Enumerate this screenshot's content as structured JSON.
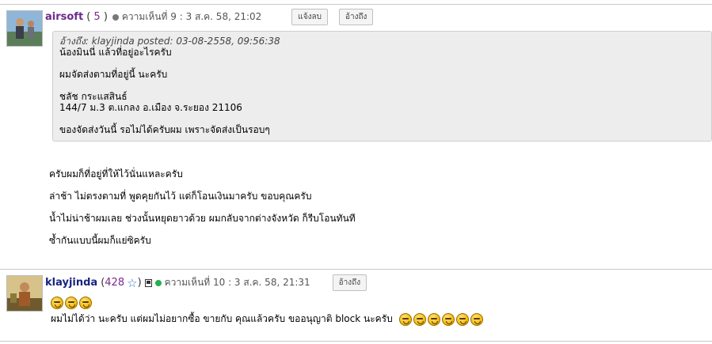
{
  "colors": {
    "accent_purple": "#6b2a8c",
    "username_blue": "#1a237e",
    "online_green": "#22b14c",
    "offline_gray": "#777777"
  },
  "posts": [
    {
      "username": "airsoft",
      "count_open": "(",
      "count": "5",
      "count_close": ")",
      "status": "offline",
      "meta": "ความเห็นที่ 9 : 3 ส.ค. 58, 21:02",
      "buttons": {
        "notify": "แจ้งลบ",
        "reply": "อ้างถึง"
      },
      "quote": {
        "header": "อ้างถึง: klayjinda posted: 03-08-2558, 09:56:38",
        "lines": [
          "น้องมินนี่ แล้วที่อยู่อะไรครับ",
          "ผมจัดส่งตามที่อยู่นี้ นะครับ",
          "ชลัช กระแสสินธ์",
          "144/7 ม.3 ต.แกลง อ.เมือง จ.ระยอง 21106",
          "ของจัดส่งวันนี้ รอไม่ได้ครับผม เพราะจัดส่งเป็นรอบๆ"
        ]
      },
      "body": [
        "ครับผมก็ที่อยู่ที่ให้ไว้นั่นแหละครับ",
        "ล่าช้า ไม่ตรงตามที่ พูดคุยกันไว้ แต่ก็โอนเงินมาครับ ขอบคุณครับ",
        "น้ำไม่น่าช้าผมเลย ช่วงนั้นหยุดยาวด้วย ผมกลับจากต่างจังหวัด ก็รีบโอนทันที",
        "ซ้ำกันแบบนี้ผมก็แย่ซิครับ"
      ]
    },
    {
      "username": "klayjinda",
      "count_open": "(",
      "count": "428",
      "count_close": ")",
      "status": "online",
      "meta": "ความเห็นที่ 10 : 3 ส.ค. 58, 21:31",
      "buttons": {
        "reply": "อ้างถึง"
      },
      "body": [
        "ผมไม่ได้ว่า นะครับ  แต่ผมไม่อยากซื้อ ขายกับ คุณแล้วครับ ขออนุญาติ block นะครับ"
      ]
    }
  ]
}
